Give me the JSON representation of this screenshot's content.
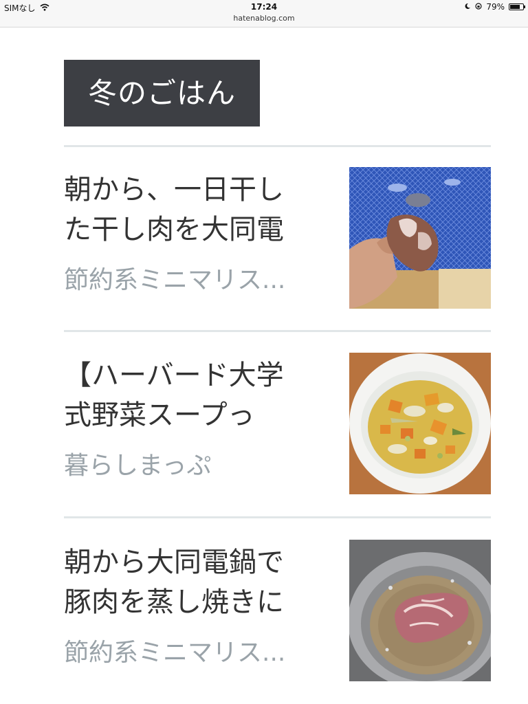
{
  "status_bar": {
    "carrier": "SIMなし",
    "time": "17:24",
    "url": "hatenablog.com",
    "battery": "79%",
    "battery_level": 0.79
  },
  "category": {
    "label": "冬のごはん"
  },
  "entries": [
    {
      "title_line1": "朝から、一日干し",
      "title_line2": "た干し肉を大同電",
      "source": "節約系ミニマリス...",
      "image": "dried-meat-photo"
    },
    {
      "title_line1": "【ハーバード大学",
      "title_line2": "式野菜スープっ",
      "source": "暮らしまっぷ",
      "image": "vegetable-soup-photo"
    },
    {
      "title_line1": "朝から大同電鍋で",
      "title_line2": "豚肉を蒸し焼きに",
      "source": "節約系ミニマリス...",
      "image": "steamed-pork-photo"
    }
  ]
}
